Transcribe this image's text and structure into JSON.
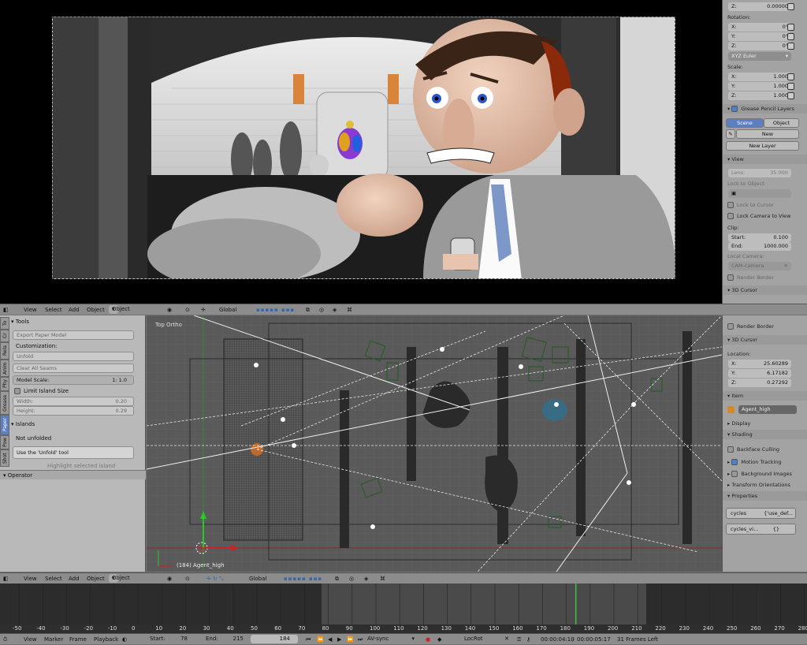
{
  "camera_panel": {
    "z_label": "Z:",
    "z_value": "0.00000",
    "rotation_label": "Rotation:",
    "rot_x_label": "X:",
    "rot_x": "0°",
    "rot_y_label": "Y:",
    "rot_y": "0°",
    "rot_z_label": "Z:",
    "rot_z": "0°",
    "rot_mode": "XYZ Euler",
    "scale_label": "Scale:",
    "scale_x_label": "X:",
    "scale_x": "1.000",
    "scale_y_label": "Y:",
    "scale_y": "1.000",
    "scale_z_label": "Z:",
    "scale_z": "1.000",
    "grease_pencil_layers": "Grease Pencil Layers",
    "scene_tab": "Scene",
    "object_tab": "Object",
    "new_button": "New",
    "new_layer_button": "New Layer",
    "view_header": "View",
    "lens_label": "Lens:",
    "lens_value": "35.000",
    "lock_to_object": "Lock to Object:",
    "lock_to_cursor": "Lock to Cursor",
    "lock_camera_to_view": "Lock Camera to View",
    "clip_label": "Clip:",
    "clip_start_label": "Start:",
    "clip_start": "0.100",
    "clip_end_label": "End:",
    "clip_end": "1000.000",
    "local_camera": "Local Camera:",
    "cam_name": "CAM-camera",
    "render_border": "Render Border",
    "cursor_3d": "3D Cursor"
  },
  "viewport_header": {
    "view": "View",
    "select": "Select",
    "add": "Add",
    "object": "Object",
    "mode": "Object Mode",
    "orientation": "Global"
  },
  "tool_shelf": {
    "tabs": [
      "To",
      "Cr",
      "Rela",
      "Anim",
      "Phy",
      "Grease",
      "Paper",
      "Pow",
      "Shot"
    ],
    "tools_header": "Tools",
    "export_paper_model": "Export Paper Model",
    "customization": "Customization:",
    "unfold": "Unfold",
    "clear_all_seams": "Clear All Seams",
    "model_scale_label": "Model Scale:",
    "model_scale": "1: 1.0",
    "limit_island_size": "Limit Island Size",
    "width_label": "Width:",
    "width_value": "0.20",
    "height_label": "Height:",
    "height_value": "0.29",
    "islands_header": "Islands",
    "not_unfolded": "Not unfolded",
    "use_unfold": "Use the 'Unfold' tool",
    "highlight_selected": "Highlight selected island",
    "operator_header": "Operator"
  },
  "viewport": {
    "ortho_label": "Top Ortho",
    "object_label": "(184) Agent_high"
  },
  "properties_panel": {
    "render_border": "Render Border",
    "cursor_header": "3D Cursor",
    "location_label": "Location:",
    "loc_x_label": "X:",
    "loc_x": "25.60289",
    "loc_y_label": "Y:",
    "loc_y": "6.17182",
    "loc_z_label": "Z:",
    "loc_z": "0.27292",
    "item_header": "Item",
    "item_name": "Agent_high",
    "display_header": "Display",
    "shading_header": "Shading",
    "backface_culling": "Backface Culling",
    "motion_tracking": "Motion Tracking",
    "background_images": "Background Images",
    "transform_orientations": "Transform Orientations",
    "properties_header": "Properties",
    "prop1_name": "cycles",
    "prop1_value": "{'use_def...",
    "prop2_name": "cycles_vi...",
    "prop2_value": "{}"
  },
  "timeline": {
    "ticks": [
      "-50",
      "-40",
      "-30",
      "-20",
      "-10",
      "0",
      "10",
      "20",
      "30",
      "40",
      "50",
      "60",
      "70",
      "80",
      "90",
      "100",
      "110",
      "120",
      "130",
      "140",
      "150",
      "160",
      "170",
      "180",
      "190",
      "200",
      "210",
      "220",
      "230",
      "240",
      "250",
      "260",
      "270",
      "280"
    ],
    "current_frame_marker": 184,
    "marker": "Marker",
    "frame": "Frame",
    "playback": "Playback",
    "view": "View",
    "start_label": "Start:",
    "start": "78",
    "end_label": "End:",
    "end": "215",
    "current": "184",
    "sync": "AV-sync",
    "keying": "LocRot",
    "time1": "00:00:04:10",
    "time2": "00:00:05:17",
    "frames_left": "31 Frames Left"
  },
  "colors": {
    "selection_blue": "#4c7fd0",
    "current_frame": "#40c040",
    "axis_red": "#cc2222",
    "axis_green": "#22cc22"
  }
}
